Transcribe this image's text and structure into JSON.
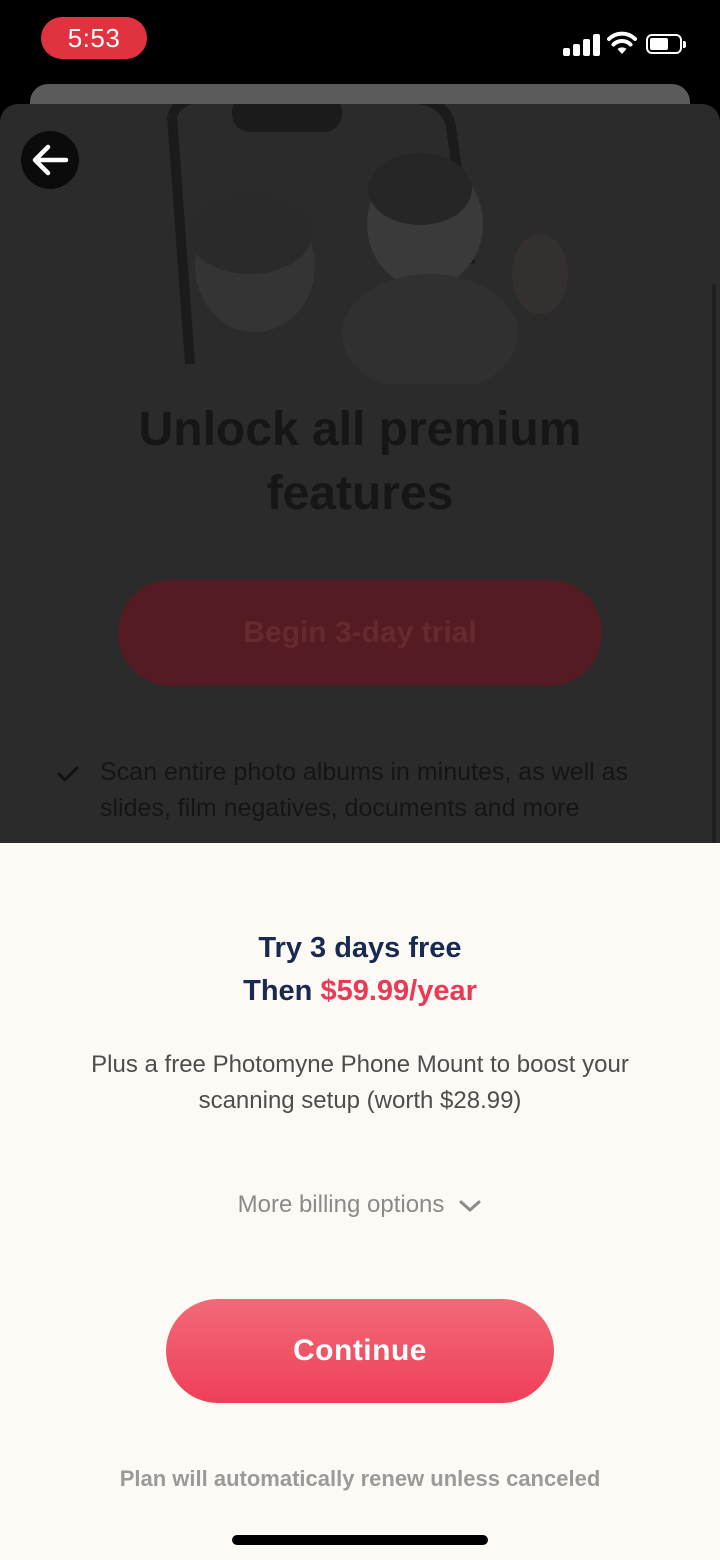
{
  "status_bar": {
    "time": "5:53",
    "icons": [
      "signal-icon",
      "wifi-icon",
      "battery-icon"
    ]
  },
  "paywall": {
    "back_icon": "arrow-left-icon",
    "headline_line1": "Unlock all premium",
    "headline_line2": "features",
    "trial_button_label": "Begin 3-day trial",
    "features": [
      {
        "icon": "check-icon",
        "text": "Scan entire photo albums in minutes, as well as slides, film negatives, documents and more"
      }
    ]
  },
  "sheet": {
    "offer_line1": "Try 3 days free",
    "offer_then": "Then ",
    "offer_price": "$59.99/year",
    "bonus_text": "Plus a free Photomyne Phone Mount to boost your scanning setup (worth $28.99)",
    "billing_options_label": "More billing options",
    "continue_label": "Continue",
    "renew_note": "Plan will automatically renew unless canceled"
  },
  "colors": {
    "accent": "#ef3f59",
    "time_pill": "#e0323f",
    "navy_text": "#182a50",
    "sheet_bg": "#fdfaf5"
  }
}
